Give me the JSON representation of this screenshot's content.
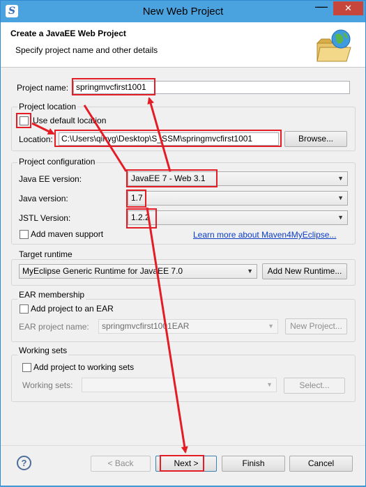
{
  "window": {
    "title": "New Web Project",
    "minimize_glyph": "—",
    "close_glyph": "✕"
  },
  "header": {
    "title": "Create a JavaEE Web Project",
    "description": "Specify project name and other details"
  },
  "project_name": {
    "label": "Project name:",
    "value": "springmvcfirst1001"
  },
  "project_location": {
    "group_title": "Project location",
    "use_default_label": "Use default location",
    "use_default_checked": false,
    "location_label": "Location:",
    "location_value": "C:\\Users\\qinyg\\Desktop\\S_SSM\\springmvcfirst1001",
    "browse_label": "Browse..."
  },
  "project_configuration": {
    "group_title": "Project configuration",
    "javaee_label": "Java EE version:",
    "javaee_value": "JavaEE 7 - Web 3.1",
    "java_label": "Java version:",
    "java_value": "1.7",
    "jstl_label": "JSTL Version:",
    "jstl_value": "1.2.2",
    "maven_label": "Add maven support",
    "maven_link": "Learn more about Maven4MyEclipse..."
  },
  "target_runtime": {
    "group_title": "Target runtime",
    "value": "MyEclipse Generic Runtime for JavaEE 7.0",
    "add_button": "Add New Runtime..."
  },
  "ear_membership": {
    "group_title": "EAR membership",
    "add_label": "Add project to an EAR",
    "project_label": "EAR project name:",
    "project_value": "springmvcfirst1001EAR",
    "new_button": "New Project..."
  },
  "working_sets": {
    "group_title": "Working sets",
    "add_label": "Add project to working sets",
    "sets_label": "Working sets:",
    "sets_value": "",
    "select_button": "Select..."
  },
  "footer": {
    "help_glyph": "?",
    "back_label": "< Back",
    "next_label": "Next >",
    "finish_label": "Finish",
    "cancel_label": "Cancel"
  },
  "icons": {
    "app": "myeclipse-icon",
    "wizard": "folder-globe-icon",
    "help": "help-icon"
  },
  "annotation_color": "#e31c25"
}
